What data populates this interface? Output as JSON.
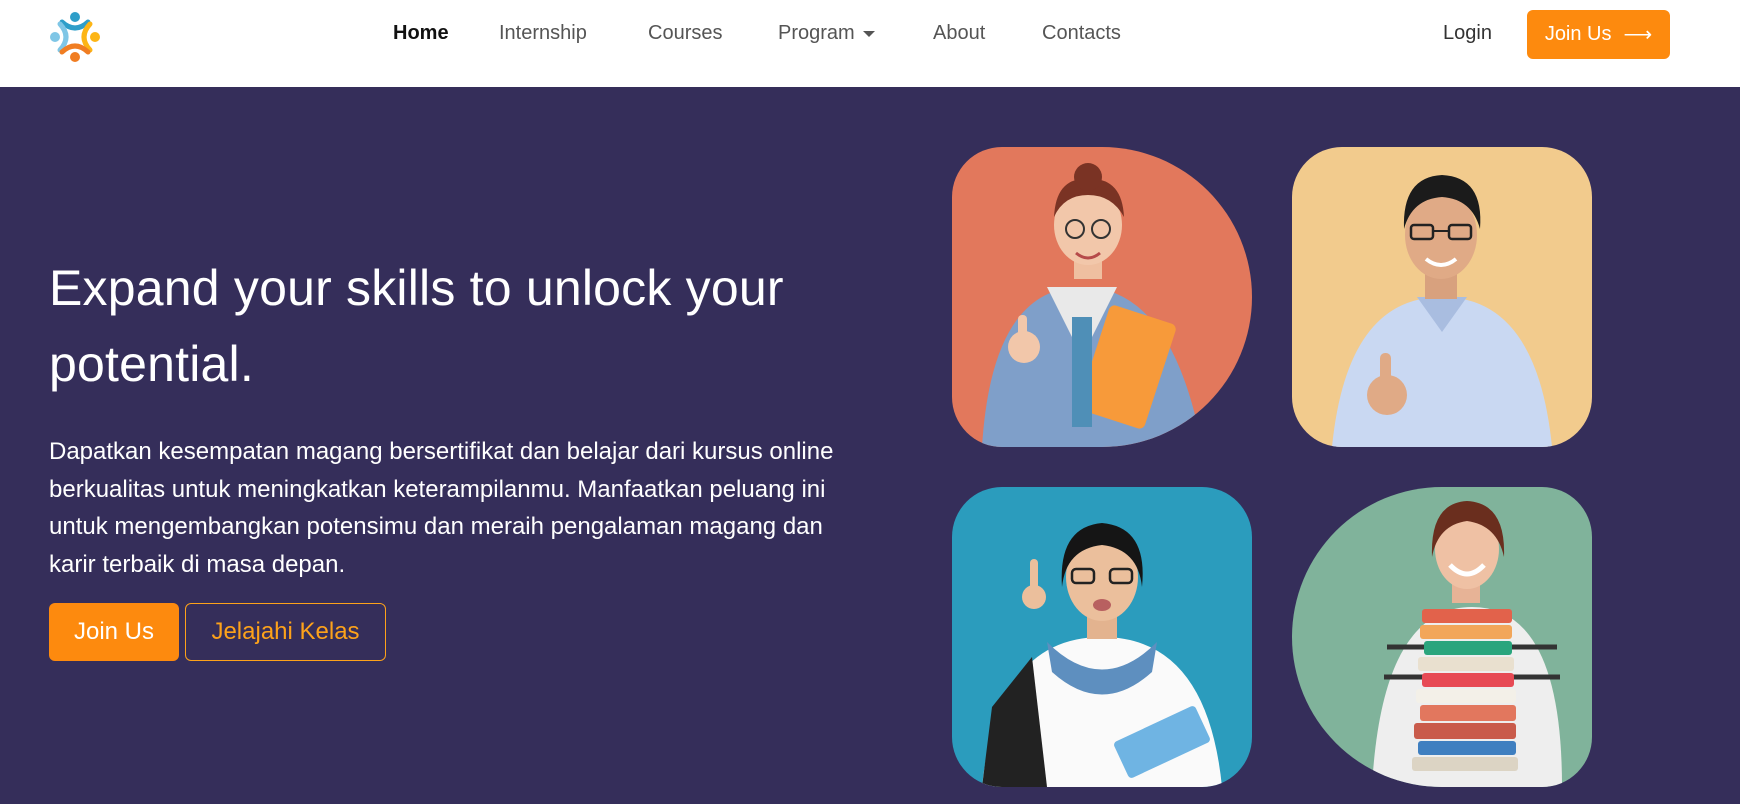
{
  "nav": {
    "logo_icon": "people-circle-logo",
    "links": [
      "Home",
      "Internship",
      "Courses",
      "Program",
      "About",
      "Contacts"
    ],
    "active": "Home",
    "login": "Login",
    "join": "Join Us",
    "join_arrow": "⟶"
  },
  "hero": {
    "headline": "Expand your skills to unlock your potential.",
    "subtext": "Dapatkan kesempatan magang bersertifikat dan belajar dari kursus online berkualitas untuk meningkatkan keterampilanmu. Manfaatkan peluang ini untuk mengembangkan potensimu dan meraih pengalaman magang dan karir terbaik di masa depan.",
    "primary_button": "Join Us",
    "secondary_button": "Jelajahi Kelas"
  },
  "photos": [
    {
      "name": "student-thumbs-up-folder",
      "bg": "#e2785c"
    },
    {
      "name": "student-thumbs-up-shirt",
      "bg": "#f2cb8d"
    },
    {
      "name": "student-with-book-backpack",
      "bg": "#2b9cbd"
    },
    {
      "name": "student-carrying-books",
      "bg": "#80b39b"
    }
  ],
  "colors": {
    "accent": "#fd8a0e",
    "hero_bg": "#352e5a",
    "outline": "#fda21a"
  }
}
